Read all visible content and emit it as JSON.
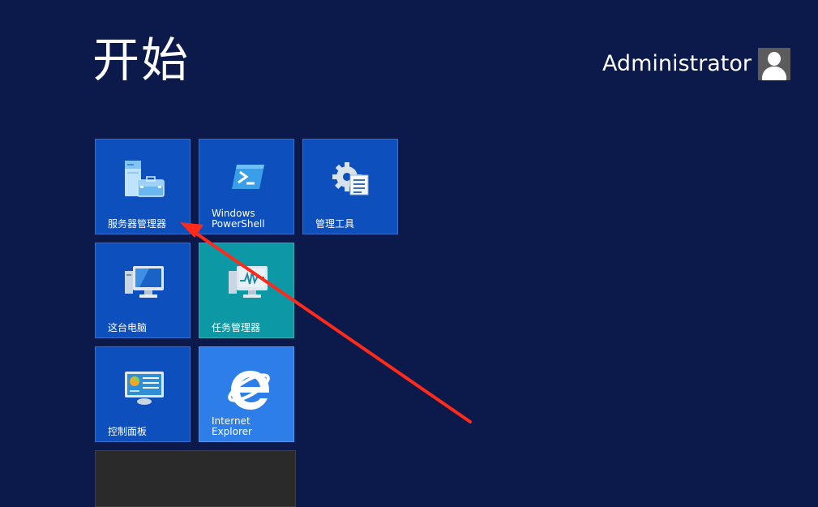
{
  "header": {
    "title": "开始",
    "user_name": "Administrator",
    "avatar_icon": "user-icon"
  },
  "tiles": [
    {
      "id": "server-manager",
      "label": "服务器管理器",
      "icon": "server-manager-icon",
      "color": "#0c4fbd"
    },
    {
      "id": "powershell",
      "label": "Windows\nPowerShell",
      "icon": "powershell-icon",
      "color": "#0c4fbd"
    },
    {
      "id": "admin-tools",
      "label": "管理工具",
      "icon": "admin-tools-icon",
      "color": "#0c4fbd"
    },
    {
      "id": "this-pc",
      "label": "这台电脑",
      "icon": "computer-icon",
      "color": "#0c4fbd"
    },
    {
      "id": "task-manager",
      "label": "任务管理器",
      "icon": "task-manager-icon",
      "color": "#0c98a4"
    },
    {
      "id": "control-panel",
      "label": "控制面板",
      "icon": "control-panel-icon",
      "color": "#0c4fbd"
    },
    {
      "id": "internet-explorer",
      "label": "Internet\nExplorer",
      "icon": "ie-icon",
      "color": "#2d7ee9"
    },
    {
      "id": "desktop",
      "label": "",
      "icon": "",
      "color": "#2a2a2a"
    }
  ],
  "annotation": {
    "type": "red-arrow",
    "color": "#ff2a1a"
  }
}
